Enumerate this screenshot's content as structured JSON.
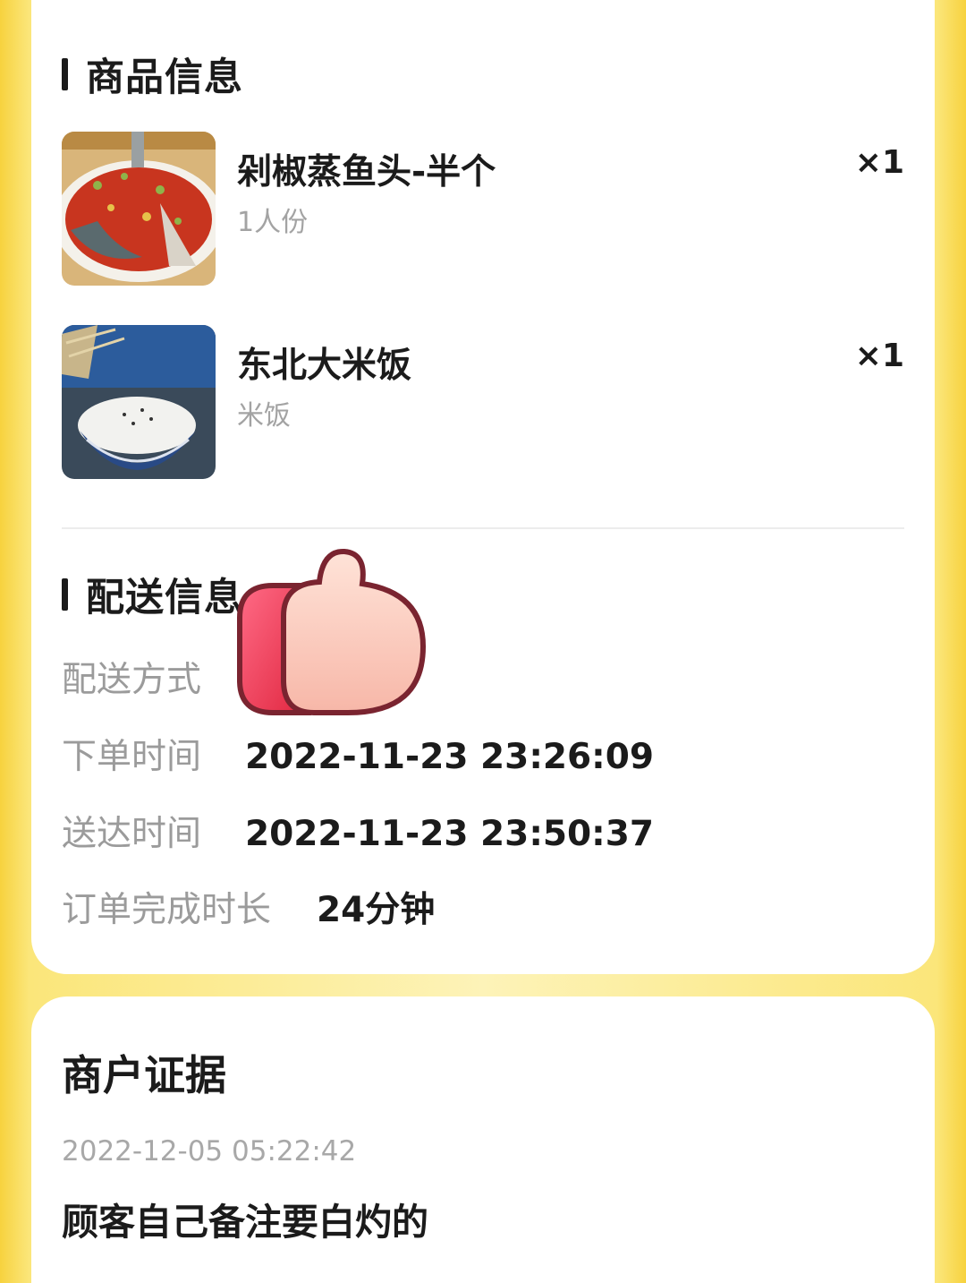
{
  "goods": {
    "title": "商品信息",
    "items": [
      {
        "name": "剁椒蒸鱼头-半个",
        "spec": "1人份",
        "qty": "×1",
        "image": "chopped-chili-fish-head-photo"
      },
      {
        "name": "东北大米饭",
        "spec": "米饭",
        "qty": "×1",
        "image": "rice-bowl-photo"
      }
    ]
  },
  "delivery": {
    "title": "配送信息",
    "method_label": "配送方式",
    "order_time_label": "下单时间",
    "order_time": "2022-11-23 23:26:09",
    "arrive_time_label": "送达时间",
    "arrive_time": "2022-11-23 23:50:37",
    "duration_label": "订单完成时长",
    "duration": "24分钟"
  },
  "evidence": {
    "title": "商户证据",
    "timestamp": "2022-12-05 05:22:42",
    "note": "顾客自己备注要白灼的"
  },
  "sticker": "thumbs-up-sticker"
}
